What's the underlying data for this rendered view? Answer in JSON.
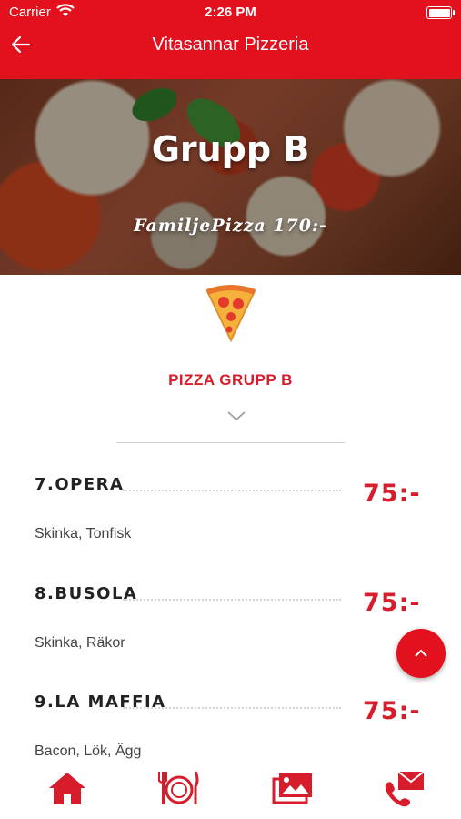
{
  "status_bar": {
    "carrier": "Carrier",
    "time": "2:26 PM"
  },
  "header": {
    "title": "Vitasannar Pizzeria"
  },
  "hero": {
    "title": "Grupp B",
    "subtitle": "FamiljePizza 170:-"
  },
  "section": {
    "title": "PIZZA GRUPP B"
  },
  "items": [
    {
      "name": "7.OPERA",
      "price": "75:-",
      "desc": "Skinka, Tonfisk"
    },
    {
      "name": "8.BUSOLA",
      "price": "75:-",
      "desc": "Skinka, Räkor"
    },
    {
      "name": "9.LA MAFFIA",
      "price": "75:-",
      "desc": "Bacon, Lök, Ägg"
    }
  ],
  "colors": {
    "accent": "#e3101e",
    "price": "#d71d2b"
  },
  "icons": [
    "back-arrow-icon",
    "pizza-slice-icon",
    "chevron-down-icon",
    "chevron-up-icon",
    "home-icon",
    "menu-plate-icon",
    "gallery-icon",
    "contact-icon"
  ]
}
